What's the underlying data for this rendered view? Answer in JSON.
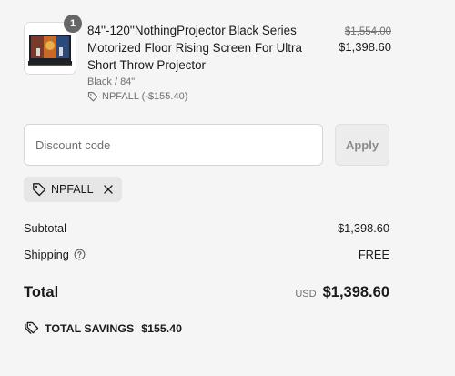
{
  "product": {
    "quantity": "1",
    "title": "84''-120''NothingProjector Black Series Motorized Floor Rising Screen For Ultra Short Throw Projector",
    "variant": "Black / 84\"",
    "discount_applied": "NPFALL (-$155.40)",
    "price_original": "$1,554.00",
    "price_current": "$1,398.60",
    "image_icon": "projector-screen-thumbnail"
  },
  "discount": {
    "placeholder": "Discount code",
    "value": "",
    "apply_label": "Apply"
  },
  "applied_code": {
    "label": "NPFALL",
    "icon": "tag-icon",
    "remove_icon": "close-icon"
  },
  "summary": {
    "subtotal_label": "Subtotal",
    "subtotal_value": "$1,398.60",
    "shipping_label": "Shipping",
    "shipping_value": "FREE",
    "total_label": "Total",
    "currency": "USD",
    "total_value": "$1,398.60",
    "savings_label": "TOTAL SAVINGS",
    "savings_value": "$155.40"
  },
  "colors": {
    "background": "#f5f5f5",
    "text": "#1a1a1a",
    "muted": "#707070",
    "badge": "#666666",
    "chip": "#e6e6e6"
  }
}
